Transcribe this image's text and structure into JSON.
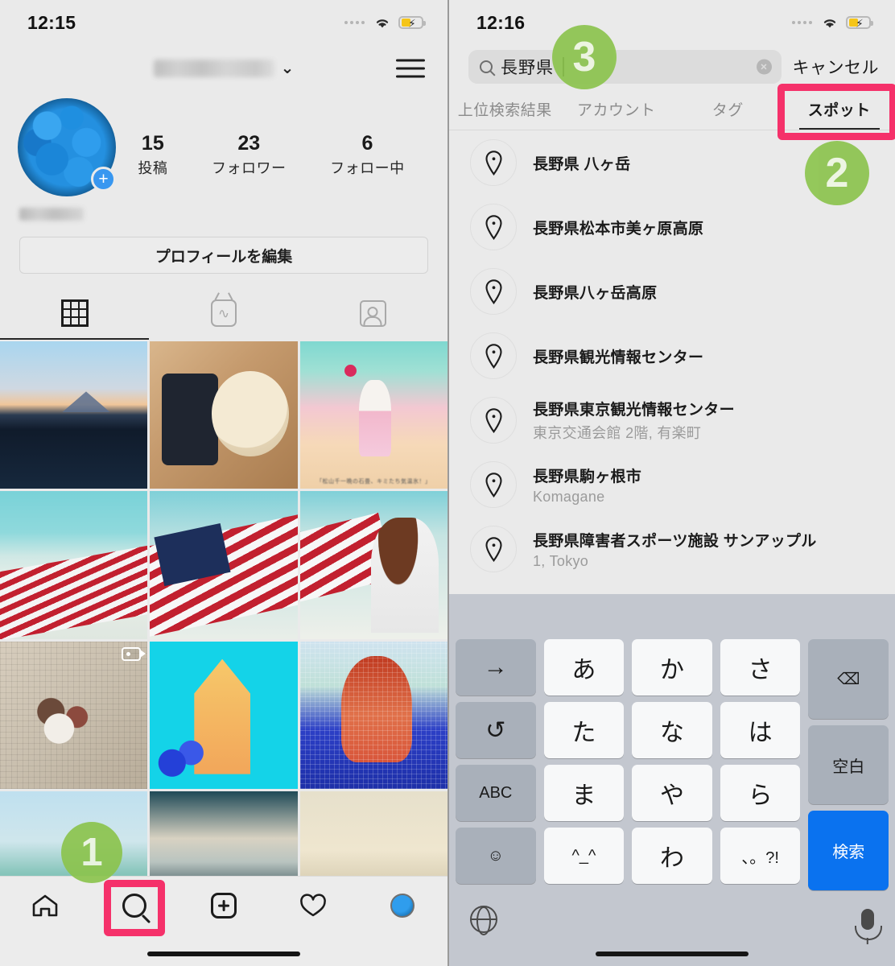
{
  "left": {
    "status": {
      "time": "12:15"
    },
    "header": {
      "username_redacted": true,
      "dropdown_icon": "chevron-down-icon",
      "menu_icon": "hamburger-menu-icon"
    },
    "profile": {
      "avatar_add_label": "+",
      "stats": [
        {
          "num": "15",
          "label": "投稿"
        },
        {
          "num": "23",
          "label": "フォロワー"
        },
        {
          "num": "6",
          "label": "フォロー中"
        }
      ],
      "edit_button": "プロフィールを編集"
    },
    "content_tabs": [
      {
        "icon": "grid-icon",
        "active": true
      },
      {
        "icon": "igtv-icon",
        "active": false
      },
      {
        "icon": "tagged-icon",
        "active": false
      }
    ],
    "grid_posts": [
      {
        "alt": "mountain-lake-sunset",
        "video": false
      },
      {
        "alt": "phone-and-latte-art",
        "video": false
      },
      {
        "alt": "woman-pink-dress-art",
        "video": false,
        "caption": "「松山千一晩の石畳、キミたち気温氷！」"
      },
      {
        "alt": "flag-beach-part-1",
        "video": false
      },
      {
        "alt": "flag-beach-part-2",
        "video": false
      },
      {
        "alt": "flag-beach-part-3",
        "video": false
      },
      {
        "alt": "dried-flower-wreath",
        "video": true
      },
      {
        "alt": "church-pop-art",
        "video": false
      },
      {
        "alt": "portrait-pixel-art",
        "video": false
      },
      {
        "alt": "seaside-watercolor",
        "video": false
      },
      {
        "alt": "city-skyline-dusk",
        "video": false
      },
      {
        "alt": "hazy-mountain-field",
        "video": false
      }
    ],
    "bottom_nav": [
      {
        "icon": "home-icon"
      },
      {
        "icon": "search-icon"
      },
      {
        "icon": "add-post-icon"
      },
      {
        "icon": "heart-activity-icon"
      },
      {
        "icon": "profile-avatar-icon"
      }
    ]
  },
  "right": {
    "status": {
      "time": "12:16"
    },
    "search": {
      "icon": "search-icon",
      "value": "長野県",
      "clear_icon": "clear-circle-icon",
      "cancel_label": "キャンセル"
    },
    "tabs": [
      {
        "label": "上位検索結果",
        "active": false
      },
      {
        "label": "アカウント",
        "active": false
      },
      {
        "label": "タグ",
        "active": false
      },
      {
        "label": "スポット",
        "active": true
      }
    ],
    "results": [
      {
        "icon": "location-pin-icon",
        "title": "長野県 八ヶ岳",
        "subtitle": ""
      },
      {
        "icon": "location-pin-icon",
        "title": "長野県松本市美ヶ原高原",
        "subtitle": ""
      },
      {
        "icon": "location-pin-icon",
        "title": "長野県八ヶ岳高原",
        "subtitle": ""
      },
      {
        "icon": "location-pin-icon",
        "title": "長野県観光情報センター",
        "subtitle": ""
      },
      {
        "icon": "location-pin-icon",
        "title": "長野県東京観光情報センター",
        "subtitle": "東京交通会館 2階, 有楽町"
      },
      {
        "icon": "location-pin-icon",
        "title": "長野県駒ヶ根市",
        "subtitle": "Komagane"
      },
      {
        "icon": "location-pin-icon",
        "title": "長野県障害者スポーツ施設 サンアップル",
        "subtitle": "1, Tokyo"
      }
    ],
    "keyboard": {
      "rows": [
        [
          "→",
          "あ",
          "か",
          "さ"
        ],
        [
          "↺",
          "た",
          "な",
          "は"
        ],
        [
          "ABC",
          "ま",
          "や",
          "ら"
        ],
        [
          "☺",
          "^_^",
          "わ",
          "、。?!"
        ]
      ],
      "right_column": [
        {
          "label": "⌫",
          "kind": "fn"
        },
        {
          "label": "空白",
          "kind": "fn"
        },
        {
          "label": "検索",
          "kind": "blue"
        }
      ],
      "globe_icon": "globe-icon",
      "mic_icon": "microphone-icon"
    }
  },
  "annotations": [
    {
      "number": "1",
      "target": "left-bottom-nav-search"
    },
    {
      "number": "2",
      "target": "right-tab-spots"
    },
    {
      "number": "3",
      "target": "right-search-field"
    }
  ],
  "colors": {
    "highlight_pink": "#f5316a",
    "badge_green": "#8cc44e",
    "keyboard_blue": "#0a72ef",
    "instagram_blue": "#3897f0"
  }
}
